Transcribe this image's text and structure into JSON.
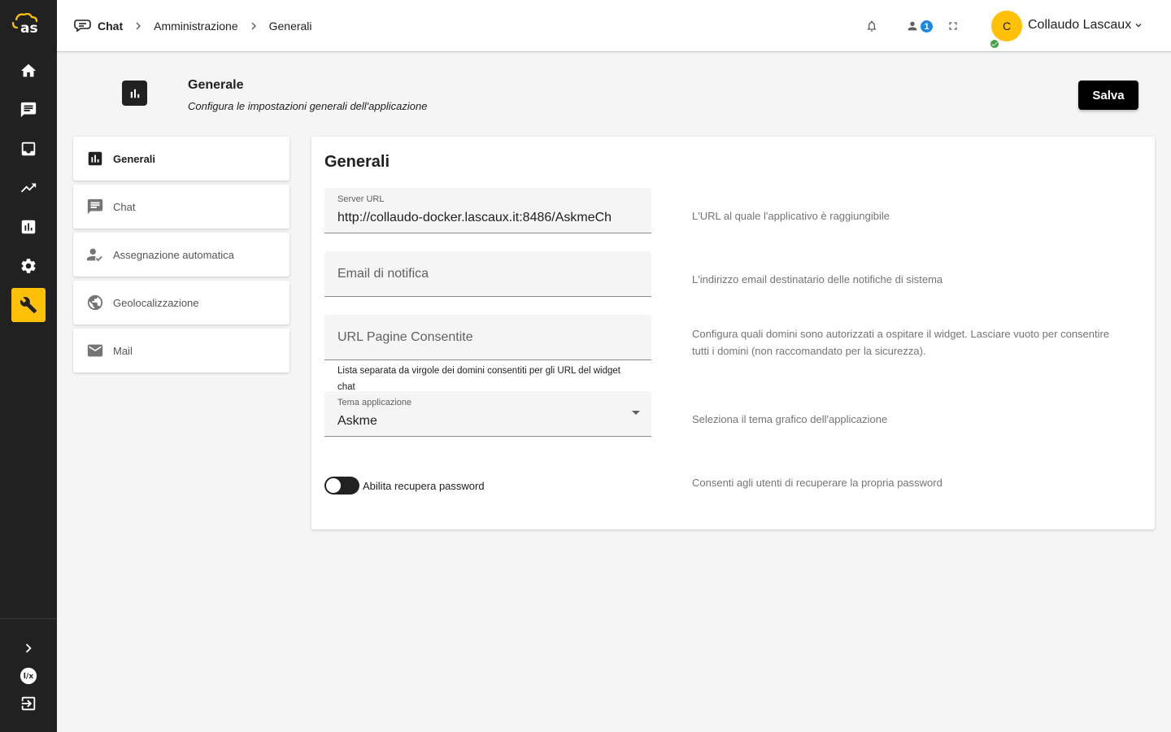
{
  "app": {
    "logo_text": "as"
  },
  "breadcrumb": {
    "items": [
      "Chat",
      "Amministrazione",
      "Generali"
    ]
  },
  "header_bar": {
    "notifications_badge": "1",
    "avatar_initial": "C",
    "user_name": "Collaudo Lascaux"
  },
  "page_header": {
    "title": "Generale",
    "subtitle": "Configura le impostazioni generali dell'applicazione",
    "save_label": "Salva"
  },
  "side_menu": {
    "items": [
      {
        "label": "Generali",
        "icon": "bar-chart-icon",
        "active": true
      },
      {
        "label": "Chat",
        "icon": "chat-icon",
        "active": false
      },
      {
        "label": "Assegnazione automatica",
        "icon": "user-check-icon",
        "active": false
      },
      {
        "label": "Geolocalizzazione",
        "icon": "globe-icon",
        "active": false
      },
      {
        "label": "Mail",
        "icon": "mail-icon",
        "active": false
      }
    ]
  },
  "settings": {
    "title": "Generali",
    "server_url": {
      "label": "Server URL",
      "value": "http://collaudo-docker.lascaux.it:8486/AskmeCh",
      "description": "L'URL al quale l'applicativo è raggiungibile"
    },
    "notification_email": {
      "placeholder": "Email di notifica",
      "description": "L'indirizzo email destinatario delle notifiche di sistema"
    },
    "allowed_pages": {
      "placeholder": "URL Pagine Consentite",
      "hint": "Lista separata da virgole dei domini consentiti per gli URL del widget chat",
      "description": "Configura quali domini sono autorizzati a ospitare il widget. Lasciare vuoto per consentire tutti i domini (non raccomandato per la sicurezza)."
    },
    "theme": {
      "label": "Tema applicazione",
      "value": "Askme",
      "description": "Seleziona il tema grafico dell'applicazione"
    },
    "password_recovery": {
      "label": "Abilita recupera password",
      "enabled": false,
      "description": "Consenti agli utenti di recuperare la propria password"
    }
  },
  "colors": {
    "accent": "#ffc107",
    "rail_bg": "#212121",
    "badge": "#1e88e5",
    "presence": "#43a047"
  }
}
